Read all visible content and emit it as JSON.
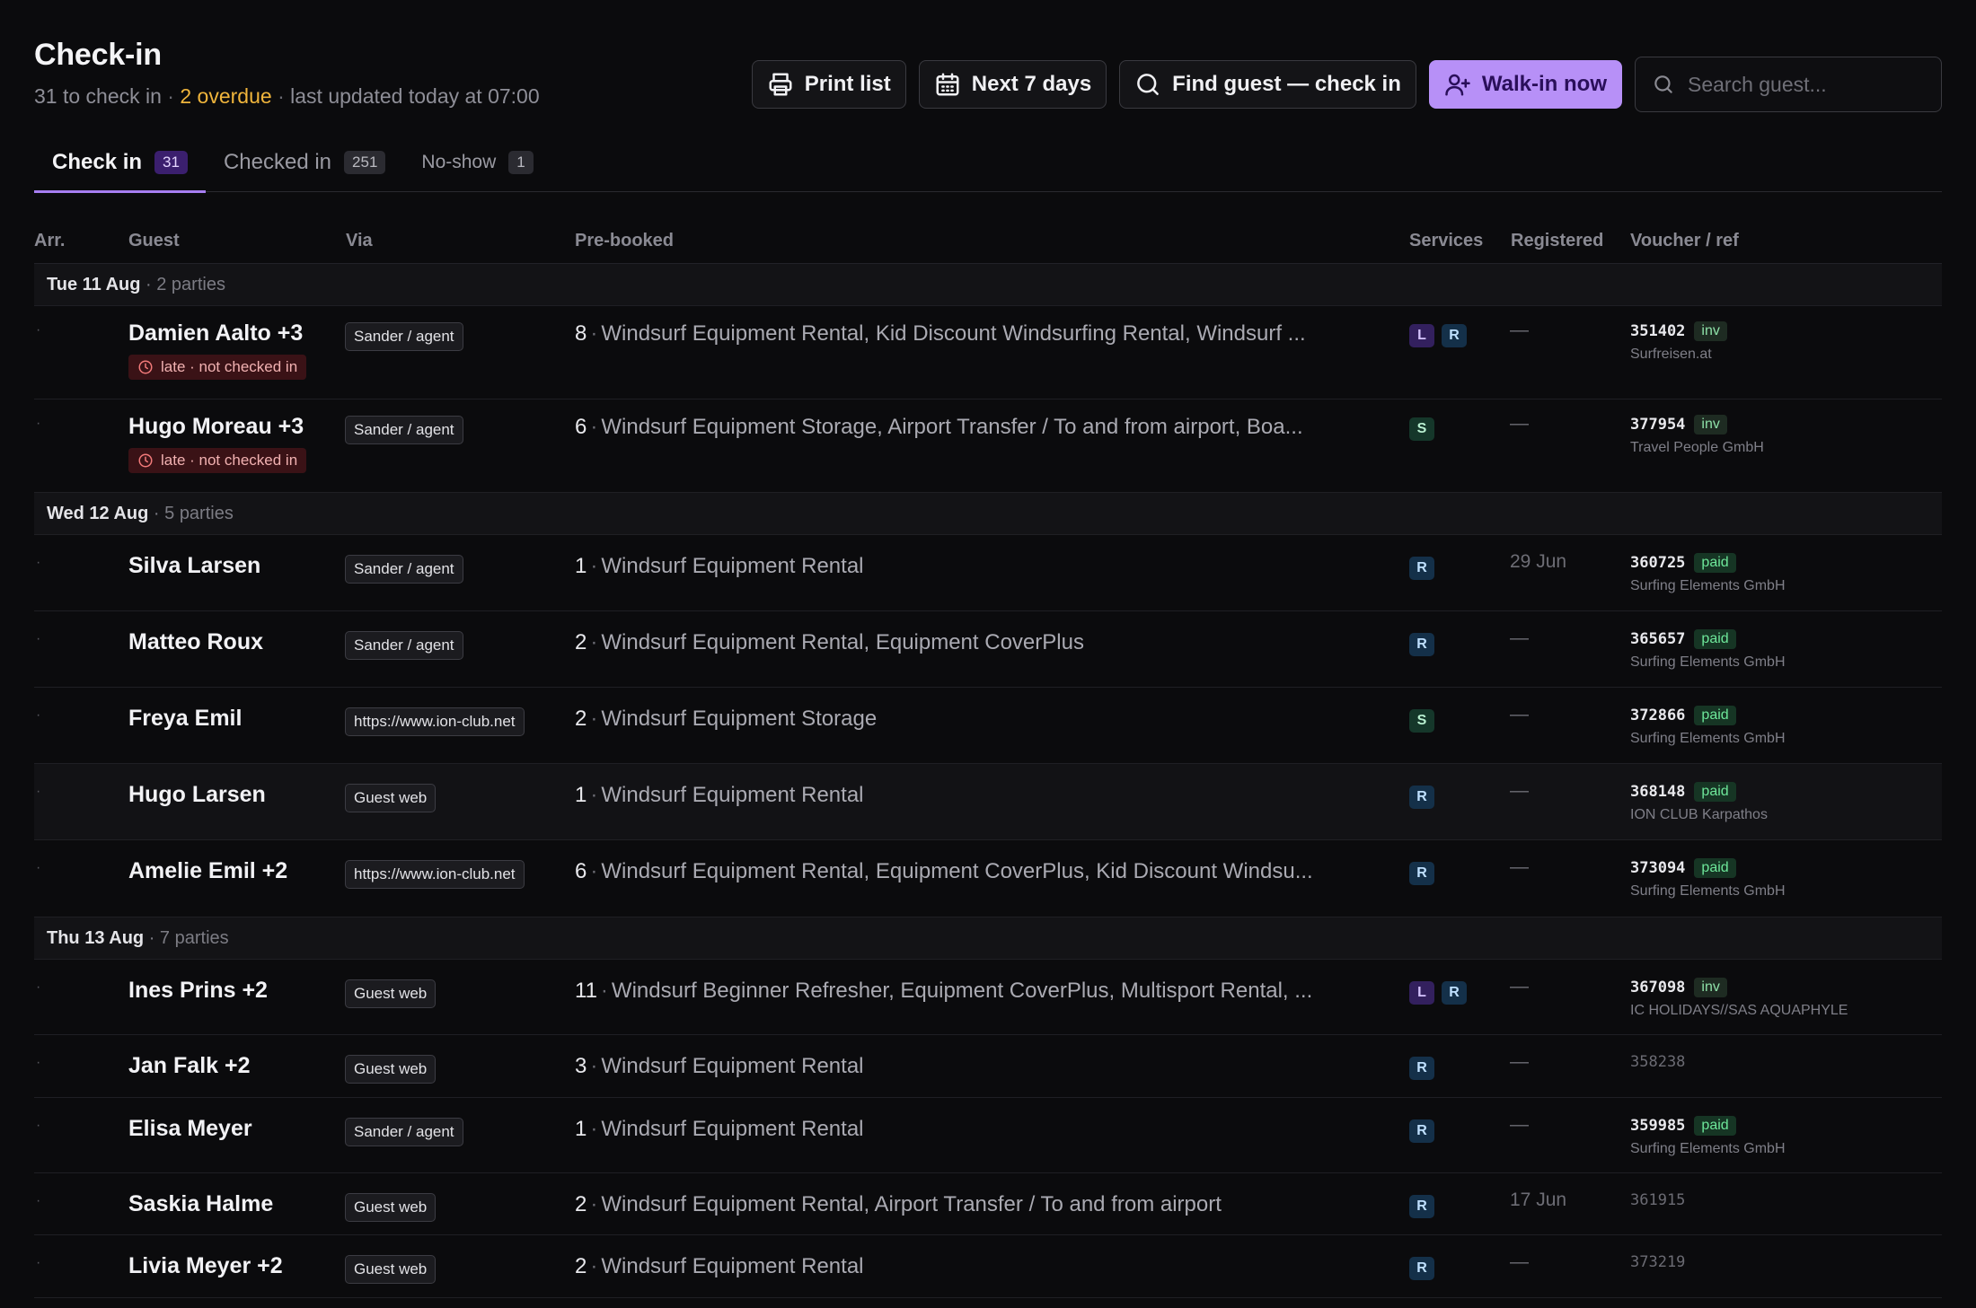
{
  "header": {
    "title": "Check-in",
    "subtitle_count": "31 to check in",
    "subtitle_sep1": " · ",
    "subtitle_overdue": "2 overdue",
    "subtitle_sep2": " · ",
    "subtitle_updated": "last updated today at 07:00"
  },
  "toolbar": {
    "print_label": "Print list",
    "range_label": "Next 7 days",
    "find_label": "Find guest — check in",
    "walkin_label": "Walk-in now",
    "search_placeholder": "Search guest...",
    "search_value": ""
  },
  "tabs": [
    {
      "label": "Check in",
      "count": "31",
      "active": true
    },
    {
      "label": "Checked in",
      "count": "251",
      "active": false
    },
    {
      "label": "No-show",
      "count": "1",
      "active": false
    }
  ],
  "columns": {
    "arr": "Arr.",
    "guest": "Guest",
    "via": "Via",
    "prebooked": "Pre-booked",
    "services": "Services",
    "registered": "Registered",
    "voucher": "Voucher / ref"
  },
  "groups": [
    {
      "date": "Tue 11 Aug",
      "parties": " · 2 parties",
      "rows": [
        {
          "arr": "·",
          "guest": "Damien Aalto +3",
          "late": "late · not checked in",
          "via": "Sander / agent",
          "qty": "8",
          "services_text": "Windsurf Equipment Rental, Kid Discount Windsurfing Rental, Windsurf ...",
          "services": [
            "L",
            "R"
          ],
          "registered": "—",
          "voucher": "351402",
          "voucher_badge": "inv",
          "company": "Surfreisen.at"
        },
        {
          "arr": "·",
          "guest": "Hugo Moreau +3",
          "late": "late · not checked in",
          "via": "Sander / agent",
          "qty": "6",
          "services_text": "Windsurf Equipment Storage, Airport Transfer / To and from airport, Boa...",
          "services": [
            "S"
          ],
          "registered": "—",
          "voucher": "377954",
          "voucher_badge": "inv",
          "company": "Travel People GmbH"
        }
      ]
    },
    {
      "date": "Wed 12 Aug",
      "parties": " · 5 parties",
      "rows": [
        {
          "arr": "·",
          "guest": "Silva Larsen",
          "via": "Sander / agent",
          "qty": "1",
          "services_text": "Windsurf Equipment Rental",
          "services": [
            "R"
          ],
          "registered": "29 Jun",
          "voucher": "360725",
          "voucher_badge": "paid",
          "company": "Surfing Elements GmbH"
        },
        {
          "arr": "·",
          "guest": "Matteo Roux",
          "via": "Sander / agent",
          "qty": "2",
          "services_text": "Windsurf Equipment Rental, Equipment CoverPlus",
          "services": [
            "R"
          ],
          "registered": "—",
          "voucher": "365657",
          "voucher_badge": "paid",
          "company": "Surfing Elements GmbH"
        },
        {
          "arr": "·",
          "guest": "Freya Emil",
          "via": "https://www.ion-club.net",
          "qty": "2",
          "services_text": "Windsurf Equipment Storage",
          "services": [
            "S"
          ],
          "registered": "—",
          "voucher": "372866",
          "voucher_badge": "paid",
          "company": "Surfing Elements GmbH"
        },
        {
          "arr": "·",
          "guest": "Hugo Larsen",
          "via": "Guest web",
          "qty": "1",
          "services_text": "Windsurf Equipment Rental",
          "services": [
            "R"
          ],
          "registered": "—",
          "voucher": "368148",
          "voucher_badge": "paid",
          "company": "ION CLUB Karpathos",
          "highlight": true
        },
        {
          "arr": "·",
          "guest": "Amelie Emil +2",
          "via": "https://www.ion-club.net",
          "qty": "6",
          "services_text": "Windsurf Equipment Rental, Equipment CoverPlus, Kid Discount Windsu...",
          "services": [
            "R"
          ],
          "registered": "—",
          "voucher": "373094",
          "voucher_badge": "paid",
          "company": "Surfing Elements GmbH"
        }
      ]
    },
    {
      "date": "Thu 13 Aug",
      "parties": " · 7 parties",
      "rows": [
        {
          "arr": "·",
          "guest": "Ines Prins +2",
          "via": "Guest web",
          "qty": "11",
          "services_text": "Windsurf Beginner Refresher, Equipment CoverPlus, Multisport Rental, ...",
          "services": [
            "L",
            "R"
          ],
          "registered": "—",
          "voucher": "367098",
          "voucher_badge": "inv",
          "company": "IC HOLIDAYS//SAS AQUAPHYLE"
        },
        {
          "arr": "·",
          "guest": "Jan Falk +2",
          "via": "Guest web",
          "qty": "3",
          "services_text": "Windsurf Equipment Rental",
          "services": [
            "R"
          ],
          "registered": "—",
          "voucher": "358238",
          "voucher_muted": true
        },
        {
          "arr": "·",
          "guest": "Elisa Meyer",
          "via": "Sander / agent",
          "qty": "1",
          "services_text": "Windsurf Equipment Rental",
          "services": [
            "R"
          ],
          "registered": "—",
          "voucher": "359985",
          "voucher_badge": "paid",
          "company": "Surfing Elements GmbH"
        },
        {
          "arr": "·",
          "guest": "Saskia Halme",
          "via": "Guest web",
          "qty": "2",
          "services_text": "Windsurf Equipment Rental, Airport Transfer / To and from airport",
          "services": [
            "R"
          ],
          "registered": "17 Jun",
          "voucher": "361915",
          "voucher_muted": true
        },
        {
          "arr": "·",
          "guest": "Livia Meyer +2",
          "via": "Guest web",
          "qty": "2",
          "services_text": "Windsurf Equipment Rental",
          "services": [
            "R"
          ],
          "registered": "—",
          "voucher": "373219",
          "voucher_muted": true
        }
      ]
    }
  ]
}
